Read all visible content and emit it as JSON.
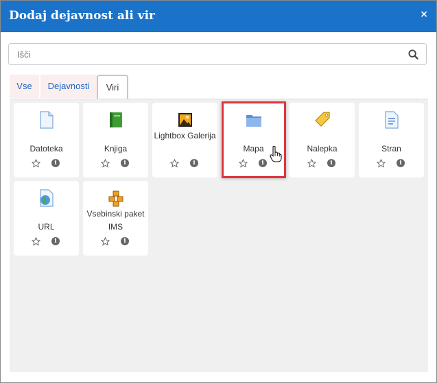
{
  "dialog": {
    "title": "Dodaj dejavnost ali vir",
    "close_glyph": "×"
  },
  "search": {
    "placeholder": "Išči"
  },
  "tabs": [
    {
      "label": "Vse"
    },
    {
      "label": "Dejavnosti"
    },
    {
      "label": "Viri",
      "active": true
    }
  ],
  "items": [
    {
      "label": "Datoteka",
      "icon": "file-icon"
    },
    {
      "label": "Knjiga",
      "icon": "book-icon"
    },
    {
      "label": "Lightbox Galerija",
      "icon": "gallery-icon"
    },
    {
      "label": "Mapa",
      "icon": "folder-icon",
      "highlighted": true
    },
    {
      "label": "Nalepka",
      "icon": "tag-icon"
    },
    {
      "label": "Stran",
      "icon": "page-icon"
    },
    {
      "label": "URL",
      "icon": "globe-icon"
    },
    {
      "label": "Vsebinski paket IMS",
      "icon": "package-icon"
    }
  ],
  "info_glyph": "i",
  "colors": {
    "header": "#1a73c9",
    "highlight": "#e0343c",
    "tab_link": "#1a66c6"
  }
}
